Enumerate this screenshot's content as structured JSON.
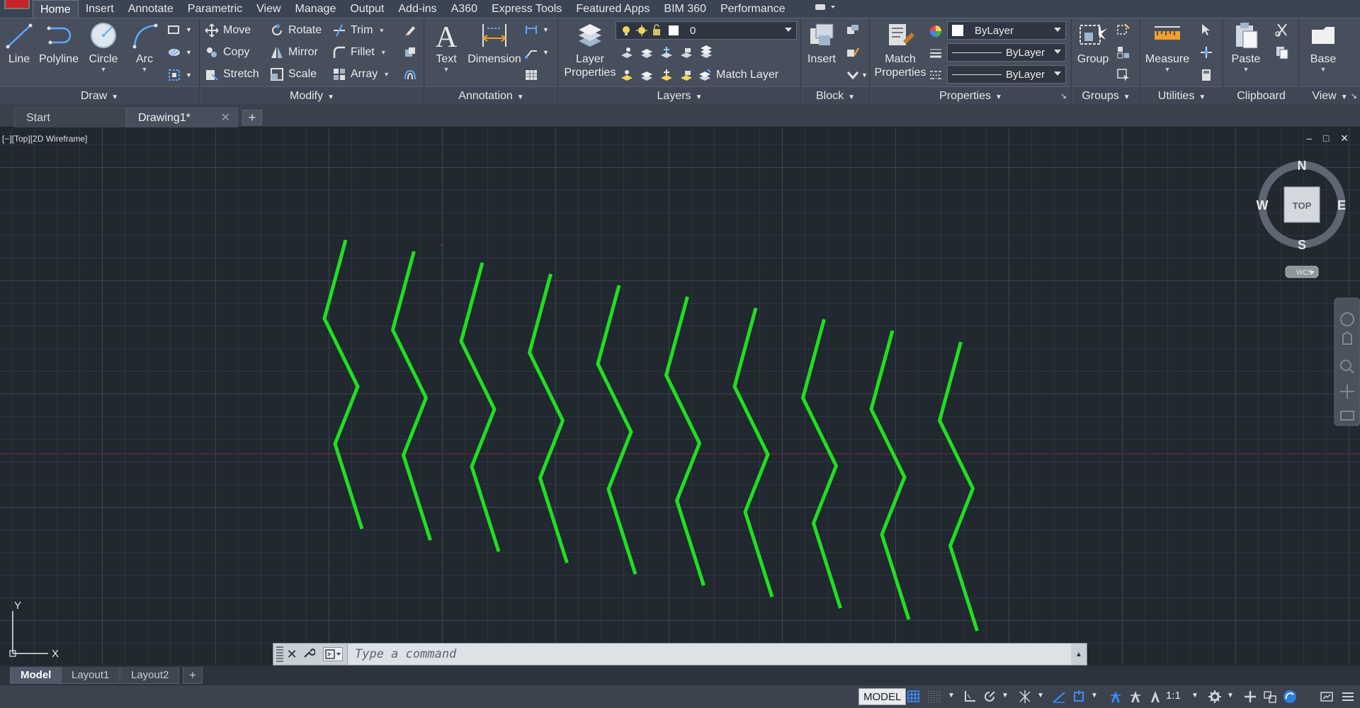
{
  "ribbon_tabs": [
    "Home",
    "Insert",
    "Annotate",
    "Parametric",
    "View",
    "Manage",
    "Output",
    "Add-ins",
    "A360",
    "Express Tools",
    "Featured Apps",
    "BIM 360",
    "Performance"
  ],
  "active_tab": "Home",
  "panels": {
    "draw": {
      "title": "Draw",
      "line": "Line",
      "polyline": "Polyline",
      "circle": "Circle",
      "arc": "Arc"
    },
    "modify": {
      "title": "Modify",
      "move": "Move",
      "rotate": "Rotate",
      "trim": "Trim",
      "copy": "Copy",
      "mirror": "Mirror",
      "fillet": "Fillet",
      "stretch": "Stretch",
      "scale": "Scale",
      "array": "Array"
    },
    "annotation": {
      "title": "Annotation",
      "text": "Text",
      "dimension": "Dimension"
    },
    "layers": {
      "title": "Layers",
      "layer_properties_1": "Layer",
      "layer_properties_2": "Properties",
      "current_layer": "0",
      "match_layer": "Match Layer"
    },
    "block": {
      "title": "Block",
      "insert": "Insert"
    },
    "properties": {
      "title": "Properties",
      "match_1": "Match",
      "match_2": "Properties",
      "color": "ByLayer",
      "linetype": "ByLayer",
      "lineweight": "ByLayer"
    },
    "groups": {
      "title": "Groups",
      "group": "Group"
    },
    "utilities": {
      "title": "Utilities",
      "measure": "Measure"
    },
    "clipboard": {
      "title": "Clipboard",
      "paste": "Paste"
    },
    "view": {
      "title": "View",
      "base": "Base"
    }
  },
  "file_tabs": {
    "start": "Start",
    "drawing": "Drawing1*",
    "new_tab_symbol": "+"
  },
  "viewport": {
    "label": "[−][Top][2D Wireframe]",
    "controls": "– □ ✕",
    "viewcube": {
      "n": "N",
      "s": "S",
      "e": "E",
      "w": "W",
      "face": "TOP",
      "wcs": "WCS"
    },
    "ucs": {
      "x": "X",
      "y": "Y"
    },
    "polyline_color": "#1ee01e",
    "zigzag_count": 10
  },
  "command_line": {
    "placeholder": "Type a command"
  },
  "layout_tabs": [
    "Model",
    "Layout1",
    "Layout2"
  ],
  "layout_add": "+",
  "status_bar": {
    "model": "MODEL",
    "scale": "1:1"
  },
  "colors": {
    "ribbon_bg": "#474f5c",
    "canvas_bg": "#212830",
    "accent": "#2f7fe0",
    "green": "#1ee01e"
  }
}
